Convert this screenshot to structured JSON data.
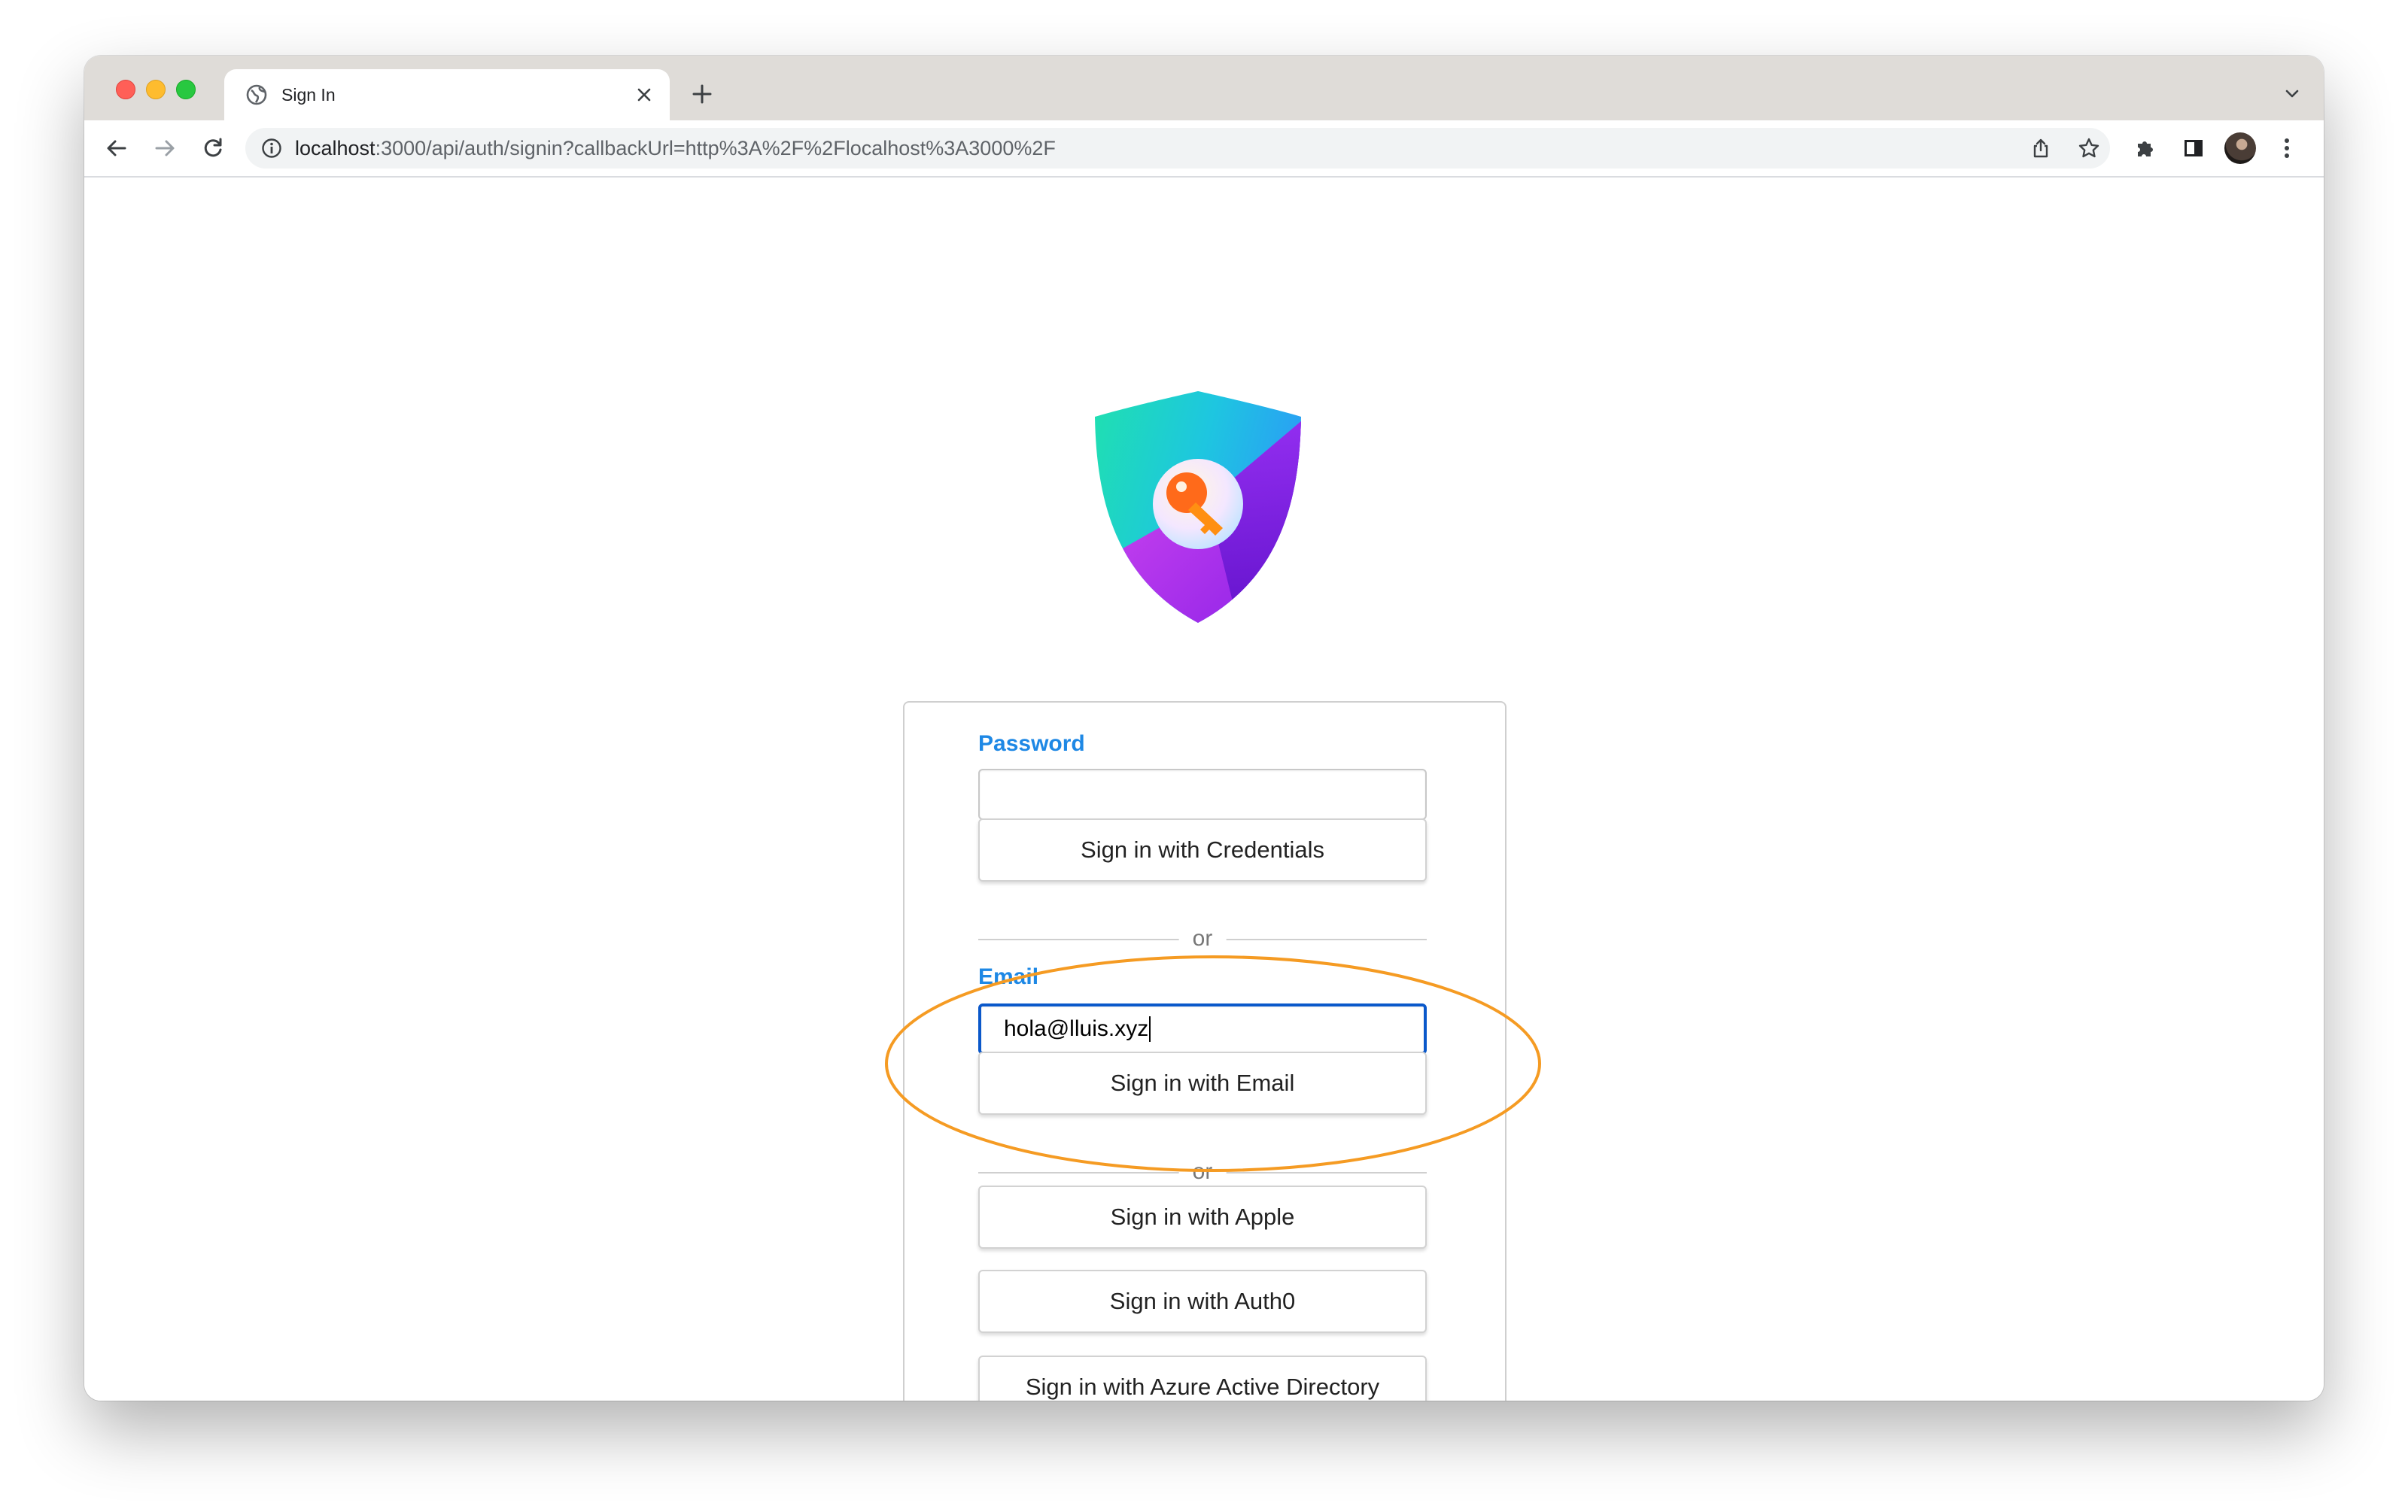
{
  "browser": {
    "tab_title": "Sign In",
    "url_host": "localhost",
    "url_rest": ":3000/api/auth/signin?callbackUrl=http%3A%2F%2Flocalhost%3A3000%2F"
  },
  "signin": {
    "password_label": "Password",
    "password_value": "",
    "credentials_button": "Sign in with Credentials",
    "or_1": "or",
    "email_label": "Email",
    "email_value": "hola@lluis.xyz",
    "email_button": "Sign in with Email",
    "or_2": "or",
    "apple_button": "Sign in with Apple",
    "auth0_button": "Sign in with Auth0",
    "azure_button": "Sign in with Azure Active Directory"
  },
  "colors": {
    "label_blue": "#1e88e5",
    "focus_blue": "#0a58ca",
    "highlight_orange": "#f59b23"
  },
  "icons": [
    "globe-icon",
    "close-icon",
    "plus-icon",
    "chevron-down-icon",
    "back-arrow-icon",
    "forward-arrow-icon",
    "reload-icon",
    "info-icon",
    "share-icon",
    "star-icon",
    "puzzle-icon",
    "side-panel-icon",
    "kebab-menu-icon",
    "shield-key-logo"
  ]
}
